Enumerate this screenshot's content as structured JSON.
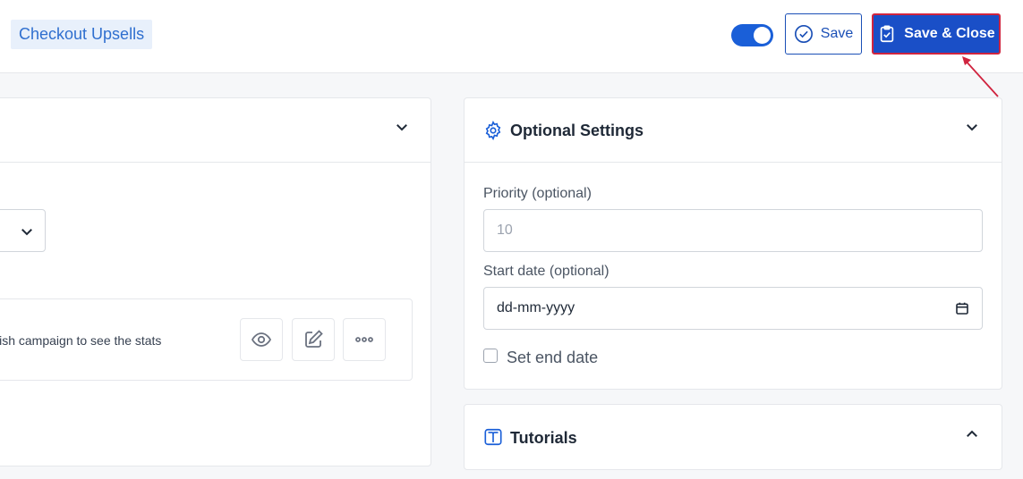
{
  "header": {
    "title": "Checkout Upsells",
    "toggle_on": true,
    "save_label": "Save",
    "save_close_label": "Save & Close"
  },
  "left_panel": {
    "stats_text": "lish campaign to see the stats",
    "actions": [
      "eye-icon",
      "edit-icon",
      "more-icon"
    ]
  },
  "optional_settings": {
    "title": "Optional Settings",
    "priority_label": "Priority (optional)",
    "priority_placeholder": "10",
    "start_date_label": "Start date (optional)",
    "start_date_value": "dd-mm-yyyy",
    "end_date_label": "Set end date",
    "end_date_checked": false
  },
  "tutorials": {
    "title": "Tutorials"
  },
  "colors": {
    "accent": "#1a4fc7",
    "highlight_border": "#d0243f",
    "title_chip_bg": "#e8f0fb"
  }
}
